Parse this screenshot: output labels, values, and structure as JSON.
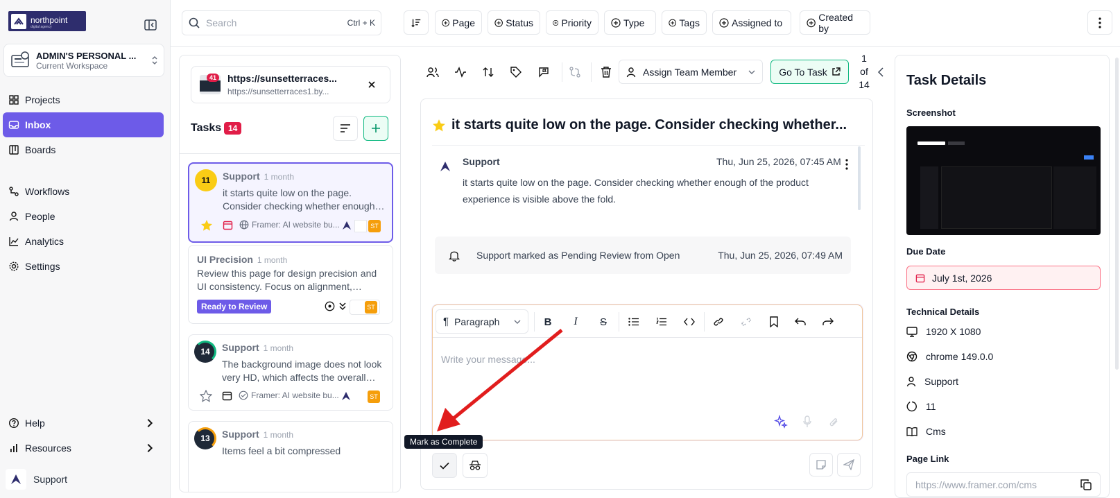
{
  "sidebar": {
    "brand": "northpoint",
    "brand_sub": "digital agency",
    "workspace": {
      "name": "ADMIN'S PERSONAL ...",
      "sub": "Current Workspace"
    },
    "items": [
      {
        "label": "Projects"
      },
      {
        "label": "Inbox"
      },
      {
        "label": "Boards"
      },
      {
        "label": "Workflows"
      },
      {
        "label": "People"
      },
      {
        "label": "Analytics"
      },
      {
        "label": "Settings"
      }
    ],
    "help": "Help",
    "resources": "Resources",
    "user": "Support"
  },
  "topbar": {
    "search_placeholder": "Search",
    "shortcut": "Ctrl + K",
    "filters": [
      "Page",
      "Status",
      "Priority",
      "Type",
      "Tags",
      "Assigned to",
      "Created by"
    ]
  },
  "tasks": {
    "link_title": "https://sunsetterraces...",
    "link_url": "https://sunsetterraces1.by...",
    "link_badge": "41",
    "heading": "Tasks",
    "count": "14",
    "items": [
      {
        "num": "11",
        "author": "Support",
        "time": "1 month",
        "text": "it starts quite low on the page. Consider checking whether enough of the product experience is visible above the fold.",
        "source": "Framer: AI website bu...",
        "initials": "ST"
      },
      {
        "author": "UI Precision",
        "time": "1 month",
        "text": "Review this page for design precision and UI consistency. Focus on alignment, spacing and typography.",
        "badge": "Ready to Review",
        "initials": "ST"
      },
      {
        "num": "14",
        "author": "Support",
        "time": "1 month",
        "text": "The background image does not look very HD, which affects the overall quality.",
        "source": "Framer: AI website bu...",
        "initials": "ST"
      },
      {
        "num": "13",
        "author": "Support",
        "time": "1 month",
        "text": "Items feel a bit compressed"
      }
    ]
  },
  "toolbar": {
    "assign": "Assign Team Member",
    "goto": "Go To Task",
    "page_of": "1",
    "of": "of",
    "page_total": "14"
  },
  "task": {
    "title": "it starts quite low on the page. Consider checking whether...",
    "comment": {
      "author": "Support",
      "date": "Thu, Jun 25, 2026, 07:45 AM",
      "text": "it starts quite low on the page. Consider checking whether enough of the product experience is visible above the fold."
    },
    "activity": {
      "text": "Support marked as Pending Review from Open",
      "date": "Thu, Jun 25, 2026, 07:49 AM"
    }
  },
  "editor": {
    "format": "Paragraph",
    "placeholder": "Write your message...",
    "tooltip": "Mark as Complete"
  },
  "details": {
    "title": "Task Details",
    "screenshot_label": "Screenshot",
    "due_label": "Due Date",
    "due_value": "July 1st, 2026",
    "tech_label": "Technical Details",
    "resolution": "1920 X 1080",
    "browser": "chrome 149.0.0",
    "user": "Support",
    "count": "11",
    "page_type": "Cms",
    "page_link_label": "Page Link",
    "page_link": "https://www.framer.com/cms"
  },
  "colors": {
    "accent": "#6d5be8",
    "danger": "#e11d48",
    "success": "#10b981",
    "star": "#facc15"
  }
}
